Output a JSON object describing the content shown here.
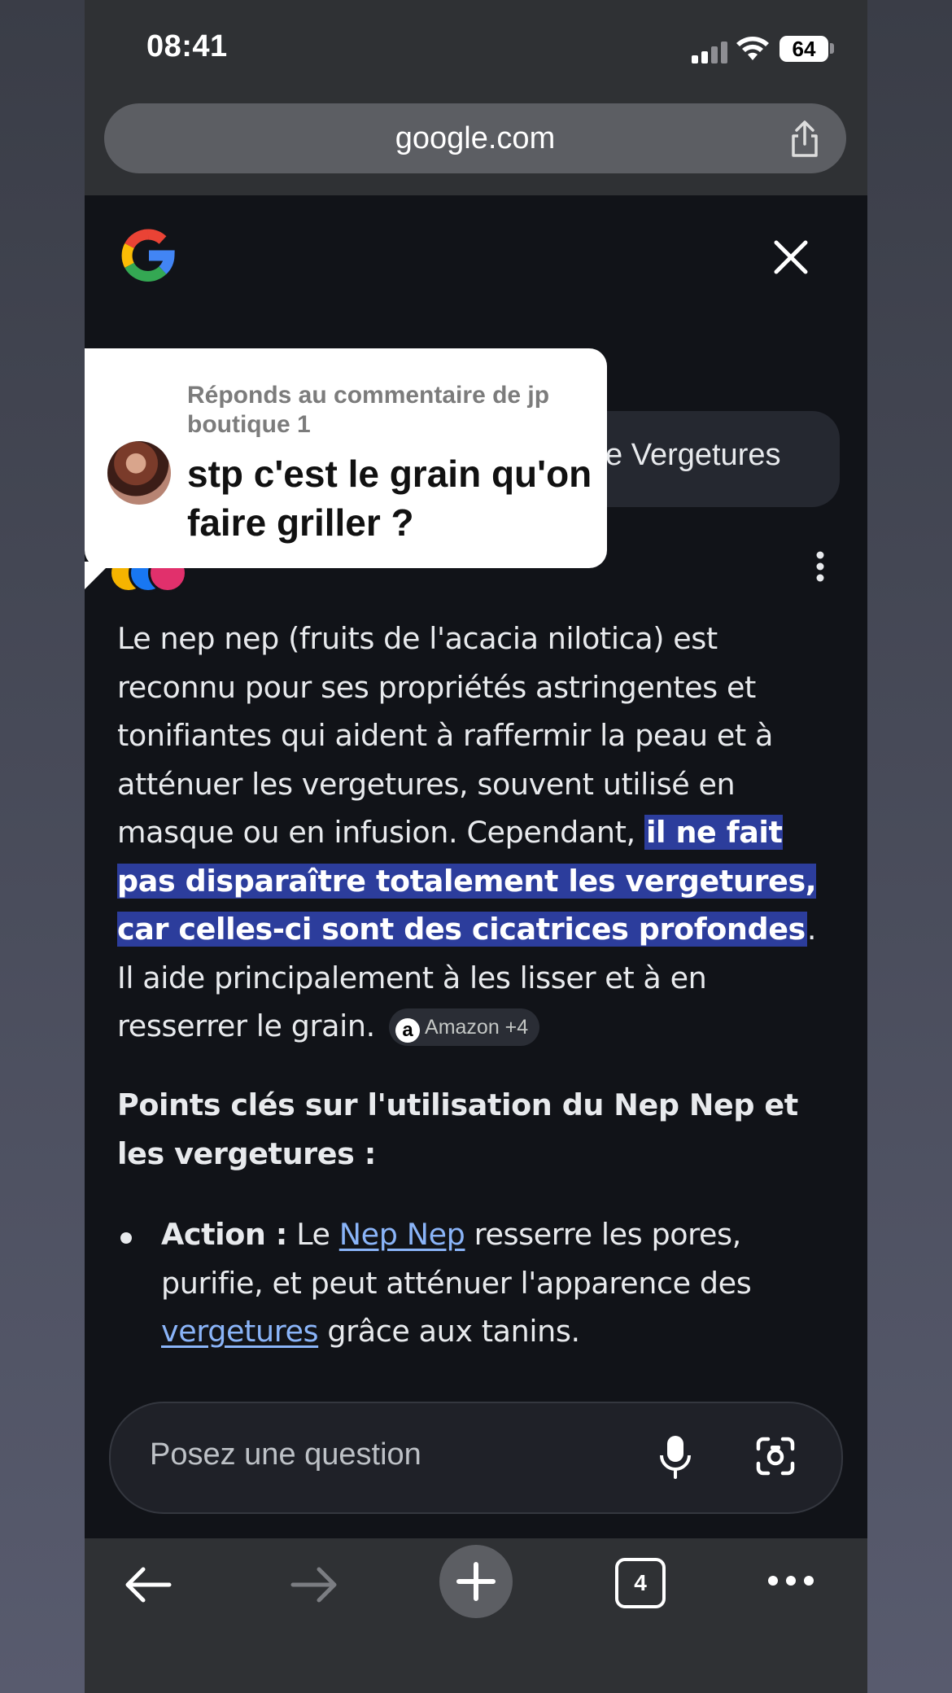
{
  "status_bar": {
    "time": "08:41",
    "battery": "64"
  },
  "url_bar": {
    "url": "google.com"
  },
  "query": {
    "text": "e Vergetures"
  },
  "comment_overlay": {
    "reply_to": "Réponds au commentaire de jp boutique 1",
    "text": "stp c'est le grain qu'on faire griller ?"
  },
  "answer": {
    "p1_before": "Le nep nep (fruits de l'acacia nilotica) est reconnu pour ses propriétés astringentes et tonifiantes qui aident à raffermir la peau et à atténuer les vergetures, souvent utilisé en masque ou en infusion. Cependant, ",
    "p1_highlight": "il ne fait pas disparaître totalement les vergetures, car celles-ci sont des cicatrices profondes",
    "p1_after": ". Il aide principalement à les lisser et à en resserrer le grain.",
    "source_chip": "Amazon +4"
  },
  "key_points": {
    "heading": "Points clés sur l'utilisation du Nep Nep et les vergetures :",
    "items": [
      {
        "label": "Action :",
        "t1": " Le ",
        "link1": "Nep Nep",
        "t2": " resserre les pores, purifie, et peut atténuer l'apparence des ",
        "link2": "vergetures",
        "t3": " grâce aux tanins."
      }
    ]
  },
  "ask_box": {
    "placeholder": "Posez une question"
  },
  "toolbar": {
    "tab_count": "4"
  },
  "colors": {
    "highlight": "#2c3d9c",
    "link": "#8ab4f8",
    "background": "#111318"
  },
  "icons": [
    "google-logo",
    "close-icon",
    "share-icon",
    "more-vert-icon",
    "mic-icon",
    "lens-icon",
    "back-icon",
    "forward-icon",
    "plus-icon",
    "menu-icon"
  ]
}
